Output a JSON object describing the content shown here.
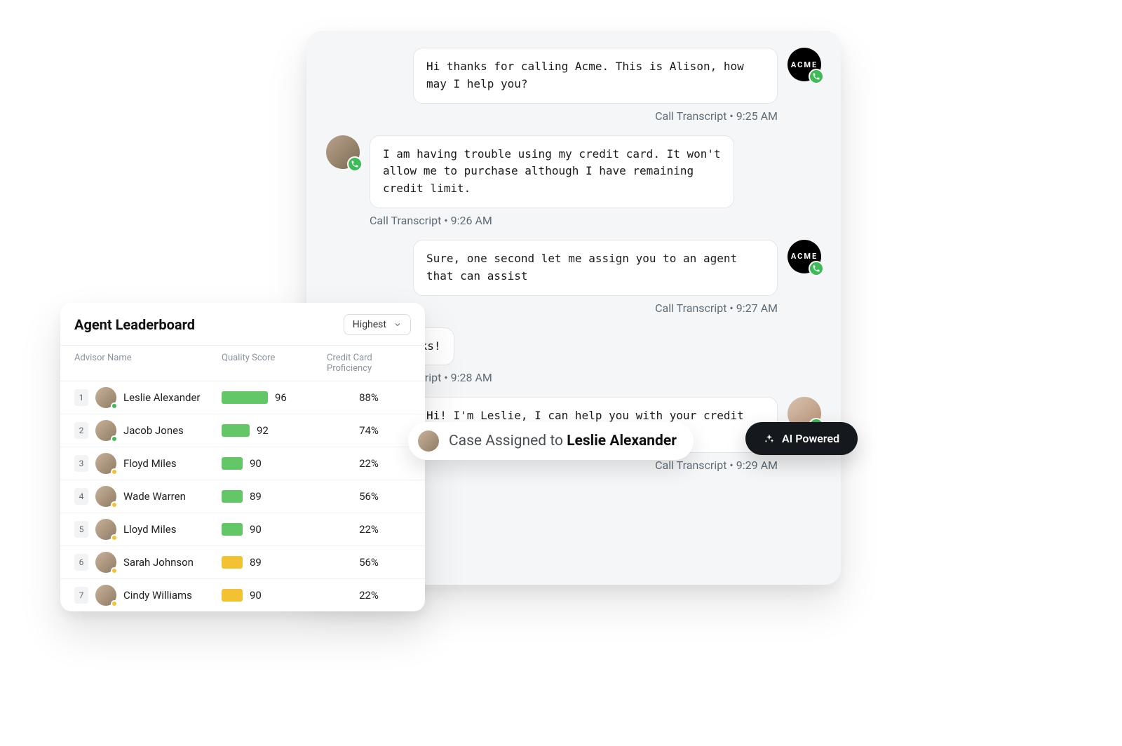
{
  "chat": {
    "meta_label": "Call Transcript",
    "agent_avatar_label": "ACME",
    "messages": [
      {
        "side": "right",
        "avatar": "acme",
        "text": "Hi thanks for calling Acme. This is Alison, how may I help you?",
        "time": "9:25 AM"
      },
      {
        "side": "left",
        "avatar": "person",
        "text": "I am having trouble using my credit card. It won't allow me to purchase although I have remaining credit limit.",
        "time": "9:26 AM"
      },
      {
        "side": "right",
        "avatar": "acme",
        "text": "Sure, one second let me assign you to an agent that can assist",
        "time": "9:27 AM"
      },
      {
        "side": "left",
        "avatar": "person",
        "text": "Awesome thanks!",
        "time": "9:28 AM",
        "no_avatar": true
      },
      {
        "side": "right",
        "avatar": "leslie",
        "text": "Hi! I'm Leslie, I can help you with your credit card troubles.",
        "time": "9:29 AM"
      }
    ]
  },
  "assigned": {
    "prefix": "Case Assigned to ",
    "name": "Leslie Alexander"
  },
  "ai_badge": "AI Powered",
  "leaderboard": {
    "title": "Agent Leaderboard",
    "sort_label": "Highest",
    "columns": {
      "advisor": "Advisor Name",
      "quality": "Quality Score",
      "proficiency": "Credit Card Proficiency"
    },
    "rows": [
      {
        "rank": "1",
        "name": "Leslie Alexander",
        "score": "96",
        "bar_pct": 66,
        "bar_color": "green",
        "status": "green",
        "proficiency": "88%"
      },
      {
        "rank": "2",
        "name": "Jacob Jones",
        "score": "92",
        "bar_pct": 40,
        "bar_color": "green",
        "status": "green",
        "proficiency": "74%"
      },
      {
        "rank": "3",
        "name": "Floyd Miles",
        "score": "90",
        "bar_pct": 30,
        "bar_color": "green",
        "status": "yellow",
        "proficiency": "22%"
      },
      {
        "rank": "4",
        "name": "Wade Warren",
        "score": "89",
        "bar_pct": 30,
        "bar_color": "green",
        "status": "yellow",
        "proficiency": "56%"
      },
      {
        "rank": "5",
        "name": "Lloyd Miles",
        "score": "90",
        "bar_pct": 30,
        "bar_color": "green",
        "status": "yellow",
        "proficiency": "22%"
      },
      {
        "rank": "6",
        "name": "Sarah Johnson",
        "score": "89",
        "bar_pct": 30,
        "bar_color": "yellow",
        "status": "yellow",
        "proficiency": "56%"
      },
      {
        "rank": "7",
        "name": "Cindy Williams",
        "score": "90",
        "bar_pct": 30,
        "bar_color": "yellow",
        "status": "yellow",
        "proficiency": "22%"
      }
    ]
  }
}
